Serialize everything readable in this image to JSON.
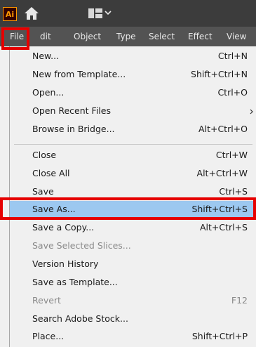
{
  "app": {
    "logo_text": "Ai",
    "logo_color": "#ff9a00",
    "icons": [
      "home-icon",
      "workspace-switcher-icon",
      "chevron-down-icon"
    ]
  },
  "menubar": {
    "items": [
      "File",
      "dit",
      "Object",
      "Type",
      "Select",
      "Effect",
      "View"
    ]
  },
  "file_menu": {
    "items": [
      {
        "label": "New...",
        "shortcut": "Ctrl+N"
      },
      {
        "label": "New from Template...",
        "shortcut": "Shift+Ctrl+N"
      },
      {
        "label": "Open...",
        "shortcut": "Ctrl+O"
      },
      {
        "label": "Open Recent Files",
        "shortcut": ""
      },
      {
        "label": "Browse in Bridge...",
        "shortcut": "Alt+Ctrl+O"
      },
      {
        "label": "Close",
        "shortcut": "Ctrl+W"
      },
      {
        "label": "Close All",
        "shortcut": "Alt+Ctrl+W"
      },
      {
        "label": "Save",
        "shortcut": "Ctrl+S"
      },
      {
        "label": "Save As...",
        "shortcut": "Shift+Ctrl+S"
      },
      {
        "label": "Save a Copy...",
        "shortcut": "Alt+Ctrl+S"
      },
      {
        "label": "Save Selected Slices...",
        "shortcut": ""
      },
      {
        "label": "Version History",
        "shortcut": ""
      },
      {
        "label": "Save as Template...",
        "shortcut": ""
      },
      {
        "label": "Revert",
        "shortcut": "F12"
      },
      {
        "label": "Search Adobe Stock...",
        "shortcut": ""
      },
      {
        "label": "Place...",
        "shortcut": "Shift+Ctrl+P"
      }
    ]
  },
  "colors": {
    "highlight": "#9cc8f0",
    "annotation_box": "#e60000"
  }
}
